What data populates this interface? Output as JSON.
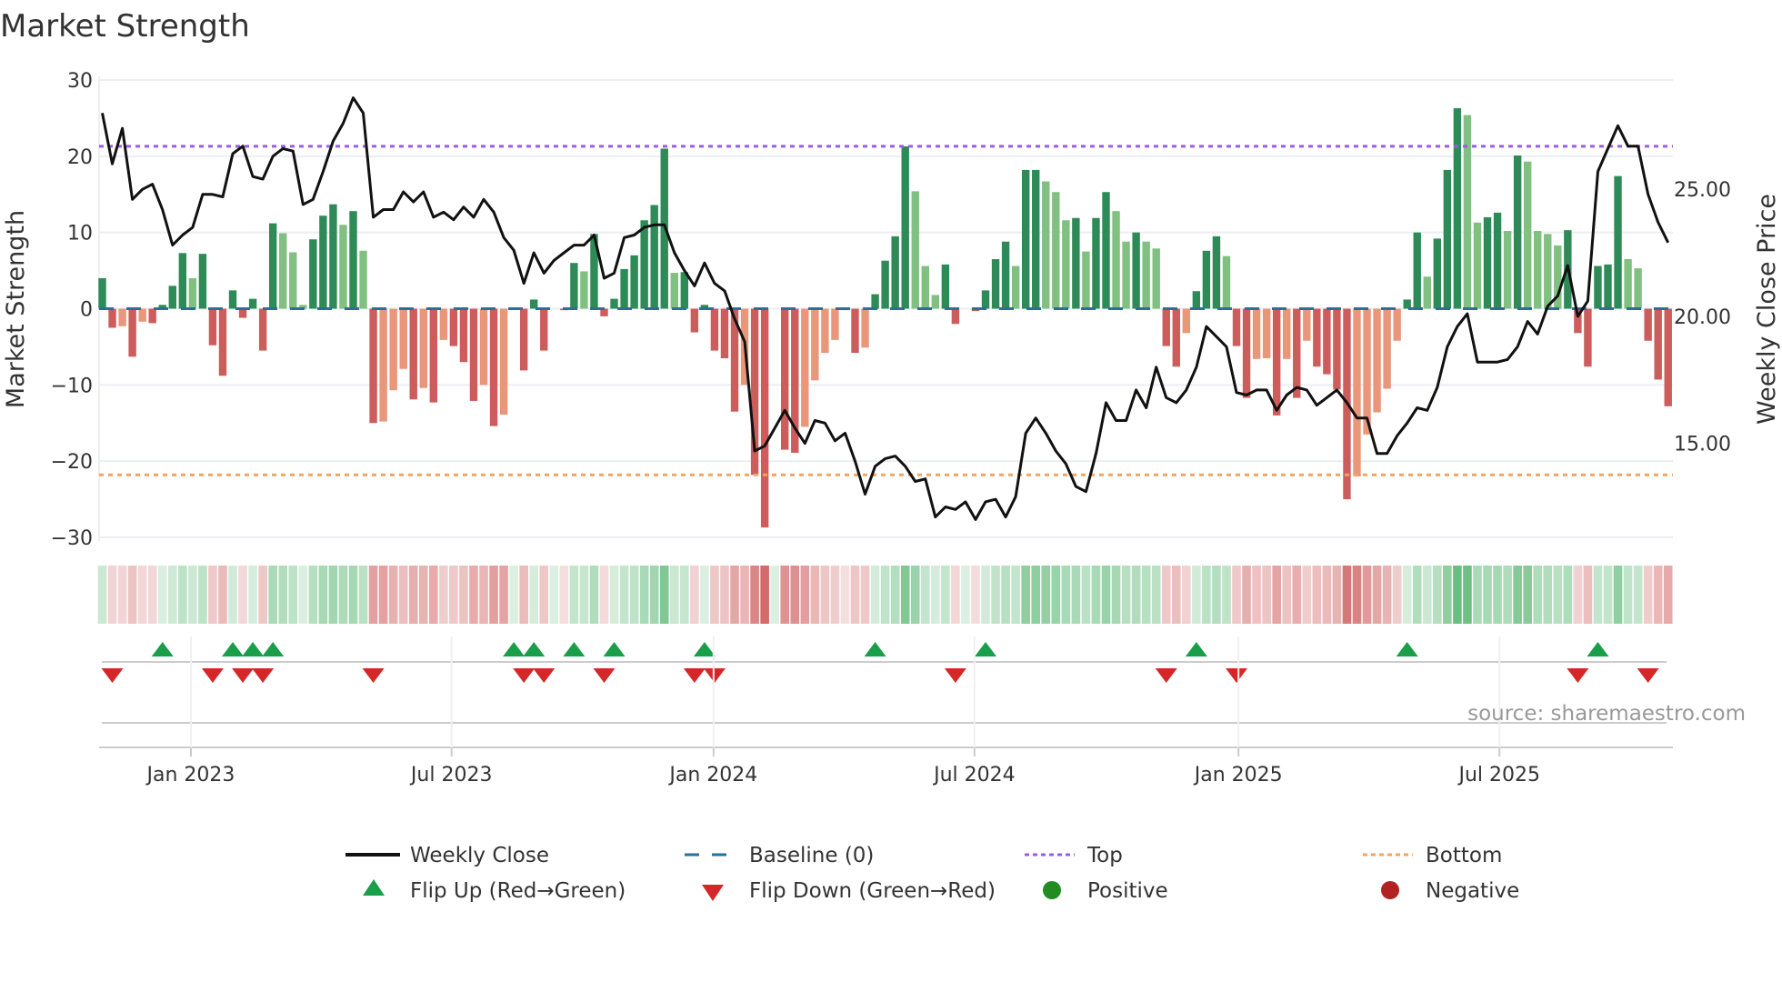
{
  "chart_data": {
    "type": "bar+line",
    "title": "Market Strength",
    "ylabel": "Market Strength",
    "y2label": "Weekly Close Price",
    "ylim": [
      -30,
      30
    ],
    "y2lim": [
      11.3,
      29.3
    ],
    "yticks": [
      "30",
      "20",
      "10",
      "0",
      "−10",
      "−20",
      "−30"
    ],
    "ytick_values": [
      30,
      20,
      10,
      0,
      -10,
      -20,
      -30
    ],
    "y2ticks": [
      "25.00",
      "20.00",
      "15.00"
    ],
    "y2tick_values": [
      25,
      20,
      15
    ],
    "x_dates": {
      "labels": [
        "Jan 2023",
        "Jul 2023",
        "Jan 2024",
        "Jul 2024",
        "Jan 2025",
        "Jul 2025"
      ],
      "week_index": [
        8.83,
        34.8,
        60.9,
        86.9,
        113.2,
        139.2
      ]
    },
    "top_level": 21.3,
    "bottom_level": -21.8,
    "strength": [
      4,
      -2.5,
      -2.3,
      -6.3,
      -1.7,
      -1.9,
      0.5,
      3,
      7.3,
      4,
      7.2,
      -4.8,
      -8.8,
      2.4,
      -1.2,
      1.3,
      -5.5,
      11.2,
      9.9,
      7.4,
      0.5,
      9.1,
      12.2,
      13.7,
      11,
      12.8,
      7.6,
      -15,
      -14.8,
      -10.7,
      -7.9,
      -11.9,
      -10.4,
      -12.3,
      -4.1,
      -4.9,
      -7,
      -12.1,
      -10,
      -15.4,
      -13.9,
      0,
      -8.1,
      1.2,
      -5.5,
      0,
      -0.2,
      6,
      4.9,
      9.8,
      -1,
      1.3,
      5.2,
      7,
      11.6,
      13.6,
      21,
      4.7,
      4.8,
      -3.1,
      0.5,
      -5.5,
      -6.5,
      -13.5,
      -10,
      -21.8,
      -28.7,
      0,
      -18.5,
      -18.9,
      -15.5,
      -9.4,
      -5.8,
      -4.1,
      -0.2,
      -5.8,
      -5.1,
      1.9,
      6.3,
      9.5,
      21.3,
      15.4,
      5.6,
      1.8,
      5.8,
      -2,
      0,
      -0.3,
      2.4,
      6.5,
      8.8,
      5.6,
      18.2,
      18.2,
      16.7,
      15.3,
      11.6,
      11.9,
      7.5,
      11.9,
      15.3,
      12.8,
      8.8,
      10,
      8.8,
      7.9,
      -4.9,
      -7.6,
      -3.2,
      2.3,
      7.6,
      9.5,
      6.9,
      -4.9,
      -11.7,
      -6.6,
      -6.5,
      -14,
      -6.6,
      -11.7,
      -4.2,
      -7.6,
      -8.6,
      -10.6,
      -25,
      -22,
      -16.5,
      -13.6,
      -10.5,
      -4.2,
      1.2,
      10,
      4.2,
      9.2,
      18.2,
      26.3,
      25.4,
      11.3,
      12,
      12.6,
      10.2,
      20.1,
      19.3,
      10.2,
      9.8,
      8.3,
      10.3,
      -3.2,
      -7.6,
      5.6,
      5.8,
      17.4,
      6.5,
      5.3,
      -4.2,
      -9.3,
      -12.8
    ],
    "weekly_close": [
      28.0,
      26.0,
      27.4,
      24.6,
      25.0,
      25.2,
      24.2,
      22.8,
      23.2,
      23.5,
      24.8,
      24.8,
      24.7,
      26.4,
      26.7,
      25.5,
      25.4,
      26.3,
      26.6,
      26.5,
      24.4,
      24.6,
      25.7,
      26.9,
      27.6,
      28.6,
      28.0,
      23.9,
      24.2,
      24.2,
      24.9,
      24.5,
      24.9,
      23.9,
      24.1,
      23.8,
      24.3,
      23.9,
      24.6,
      24.1,
      23.1,
      22.6,
      21.3,
      22.5,
      21.7,
      22.2,
      22.5,
      22.8,
      22.8,
      23.2,
      21.5,
      21.7,
      23.1,
      23.2,
      23.5,
      23.6,
      23.6,
      22.5,
      21.8,
      21.2,
      22.1,
      21.3,
      21.0,
      19.9,
      19.0,
      14.7,
      14.9,
      15.6,
      16.3,
      15.6,
      15.0,
      15.9,
      15.8,
      15.1,
      15.4,
      14.3,
      13.0,
      14.1,
      14.4,
      14.5,
      14.1,
      13.5,
      13.6,
      12.1,
      12.5,
      12.4,
      12.7,
      12.0,
      12.7,
      12.8,
      12.1,
      12.9,
      15.4,
      16.0,
      15.4,
      14.7,
      14.2,
      13.3,
      13.1,
      14.6,
      16.6,
      15.9,
      15.9,
      17.1,
      16.4,
      18.0,
      16.8,
      16.6,
      17.1,
      18.0,
      19.6,
      19.2,
      18.8,
      17.0,
      16.9,
      17.1,
      17.1,
      16.3,
      16.9,
      17.2,
      17.1,
      16.5,
      16.8,
      17.1,
      16.6,
      16.0,
      16.0,
      14.6,
      14.6,
      15.3,
      15.8,
      16.4,
      16.3,
      17.2,
      18.8,
      19.6,
      20.1,
      18.2,
      18.2,
      18.2,
      18.3,
      18.8,
      19.8,
      19.3,
      20.4,
      20.8,
      22.0,
      20.0,
      20.6,
      25.7,
      26.6,
      27.5,
      26.7,
      26.7,
      24.8,
      23.7,
      22.9
    ],
    "flip_up_weeks": [
      6,
      13,
      15,
      17,
      41,
      43,
      47,
      51,
      60,
      77,
      88,
      109,
      130,
      149
    ],
    "flip_down_weeks": [
      1,
      11,
      14,
      16,
      27,
      42,
      44,
      50,
      59,
      61,
      85,
      106,
      113,
      147,
      154
    ],
    "legend": {
      "weekly_close": "Weekly Close",
      "baseline": "Baseline (0)",
      "top": "Top",
      "bottom": "Bottom",
      "flip_up": "Flip Up (Red→Green)",
      "flip_down": "Flip Down (Green→Red)",
      "positive": "Positive",
      "negative": "Negative"
    },
    "legend_placement": "bottom",
    "source": "source: sharemaestro.com",
    "colors": {
      "green_strong": "#2e8b57",
      "green_weak": "#80c080",
      "red_strong": "#cd5c5c",
      "red_weak": "#e9967a",
      "baseline": "#2a6f97",
      "top": "#9b5de5",
      "bottom": "#f4a460",
      "line": "#111111",
      "flip_up": "#1a9e4a",
      "flip_down": "#d62728",
      "positive": "#228b22",
      "negative": "#b22222"
    }
  }
}
